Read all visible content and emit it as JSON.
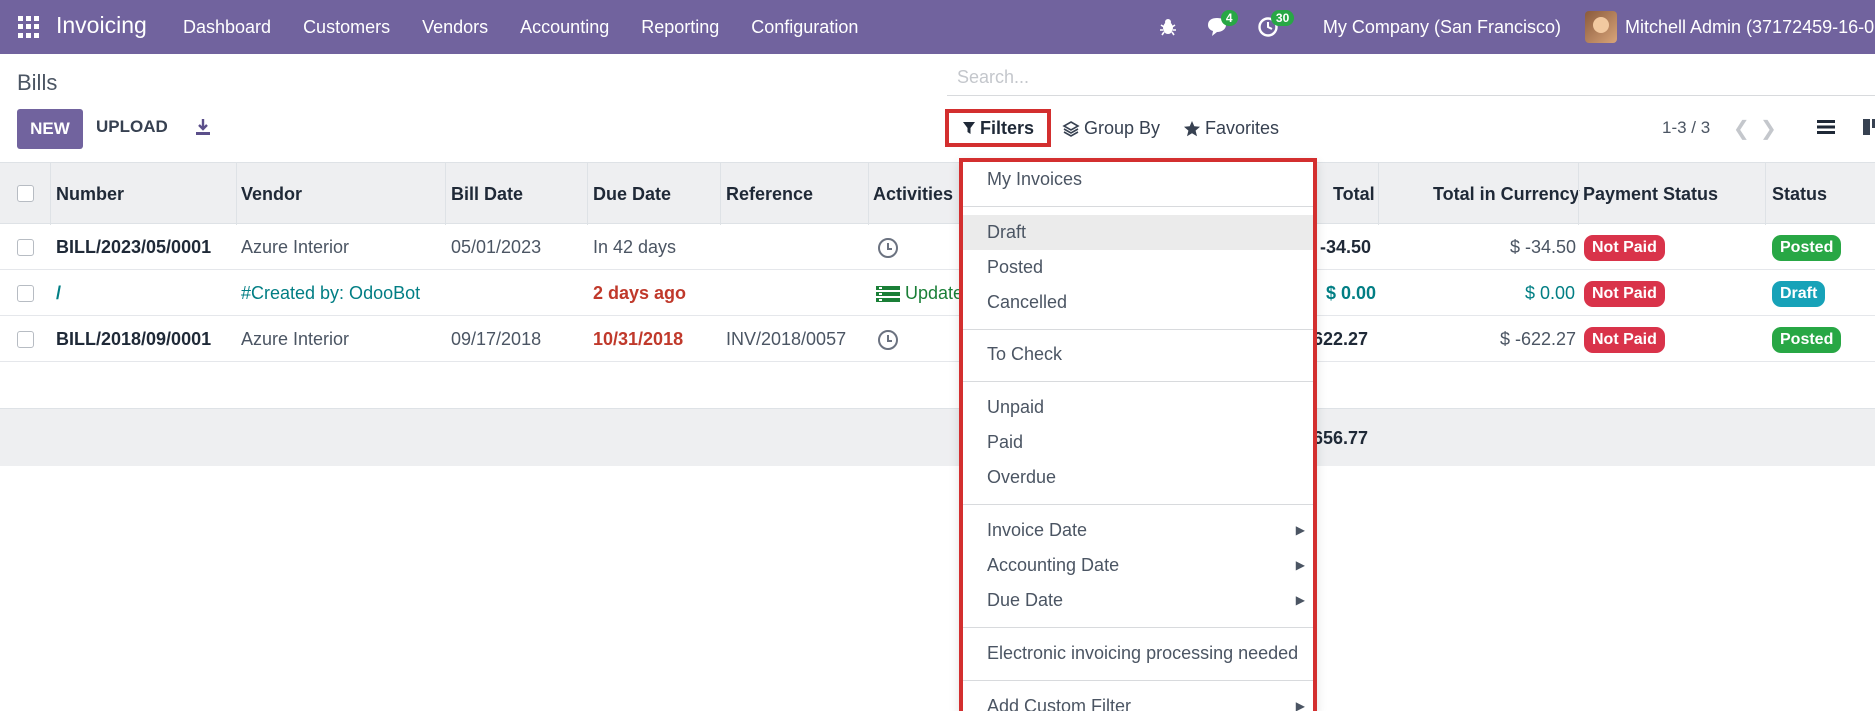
{
  "navbar": {
    "app_name": "Invoicing",
    "menu": [
      "Dashboard",
      "Customers",
      "Vendors",
      "Accounting",
      "Reporting",
      "Configuration"
    ],
    "messages_count": "4",
    "activities_count": "30",
    "company": "My Company (San Francisco)",
    "user": "Mitchell Admin (37172459-16-0"
  },
  "control": {
    "breadcrumb": "Bills",
    "search_placeholder": "Search...",
    "new_label": "NEW",
    "upload_label": "UPLOAD",
    "filters_label": "Filters",
    "group_by_label": "Group By",
    "favorites_label": "Favorites",
    "pager": "1-3 / 3"
  },
  "table": {
    "headers": {
      "number": "Number",
      "vendor": "Vendor",
      "bill_date": "Bill Date",
      "due_date": "Due Date",
      "reference": "Reference",
      "activities": "Activities",
      "total": "Total",
      "total_currency": "Total in Currency",
      "payment_status": "Payment Status",
      "status": "Status"
    },
    "rows": [
      {
        "number": "BILL/2023/05/0001",
        "vendor": "Azure Interior",
        "bill_date": "05/01/2023",
        "due_date": "In 42 days",
        "reference": "",
        "activity": "",
        "total": "-34.50",
        "total_currency": "$ -34.50",
        "payment_status": "Not Paid",
        "status": "Posted"
      },
      {
        "number": "/",
        "vendor": "#Created by: OdooBot",
        "bill_date": "",
        "due_date": "2 days ago",
        "reference": "",
        "activity": "Update",
        "total": "$ 0.00",
        "total_currency": "$ 0.00",
        "payment_status": "Not Paid",
        "status": "Draft"
      },
      {
        "number": "BILL/2018/09/0001",
        "vendor": "Azure Interior",
        "bill_date": "09/17/2018",
        "due_date": "10/31/2018",
        "reference": "INV/2018/0057",
        "activity": "",
        "total": "622.27",
        "total_currency": "$ -622.27",
        "payment_status": "Not Paid",
        "status": "Posted"
      }
    ],
    "footer_total": "656.77"
  },
  "filters_dropdown": {
    "my_invoices": "My Invoices",
    "draft": "Draft",
    "posted": "Posted",
    "cancelled": "Cancelled",
    "to_check": "To Check",
    "unpaid": "Unpaid",
    "paid": "Paid",
    "overdue": "Overdue",
    "invoice_date": "Invoice Date",
    "accounting_date": "Accounting Date",
    "due_date": "Due Date",
    "electronic": "Electronic invoicing processing needed",
    "add_custom": "Add Custom Filter"
  },
  "colors": {
    "brand": "#71639e",
    "not_paid": "#d9334a",
    "posted": "#28a745",
    "draft": "#17a2b8",
    "overdue": "#c0392b",
    "link": "#017e84",
    "highlight": "#d32f2f"
  }
}
